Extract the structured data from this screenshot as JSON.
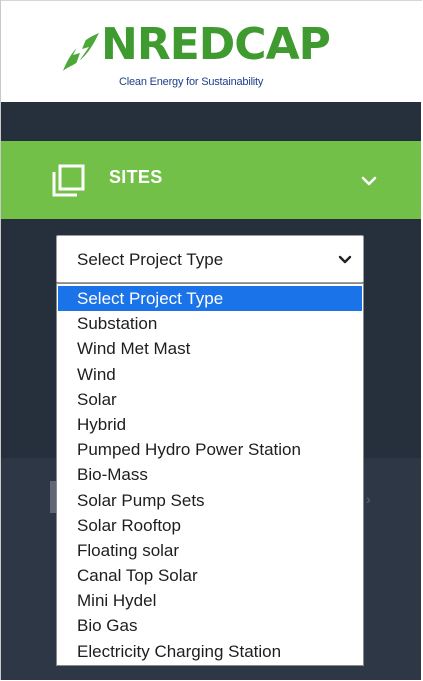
{
  "brand": {
    "name": "NREDCAP",
    "tagline": "Clean Energy for Sustainability",
    "logo_icon": "leaf-bolt-icon",
    "green": "#3f9a2f"
  },
  "sidebar": {
    "background": "#262f3c",
    "sites": {
      "label": "SITES",
      "icon": "copy-squares-icon",
      "chevron": "chevron-down-icon",
      "accent": "#72c048"
    }
  },
  "project_type_select": {
    "value": "Select Project Type",
    "options": [
      "Select Project Type",
      "Substation",
      "Wind Met Mast",
      "Wind",
      "Solar",
      "Hybrid",
      "Pumped Hydro Power Station",
      "Bio-Mass",
      "Solar Pump Sets",
      "Solar Rooftop",
      "Floating solar",
      "Canal Top Solar",
      "Mini Hydel",
      "Bio Gas",
      "Electricity Charging Station"
    ],
    "highlight_color": "#1a73e8"
  }
}
